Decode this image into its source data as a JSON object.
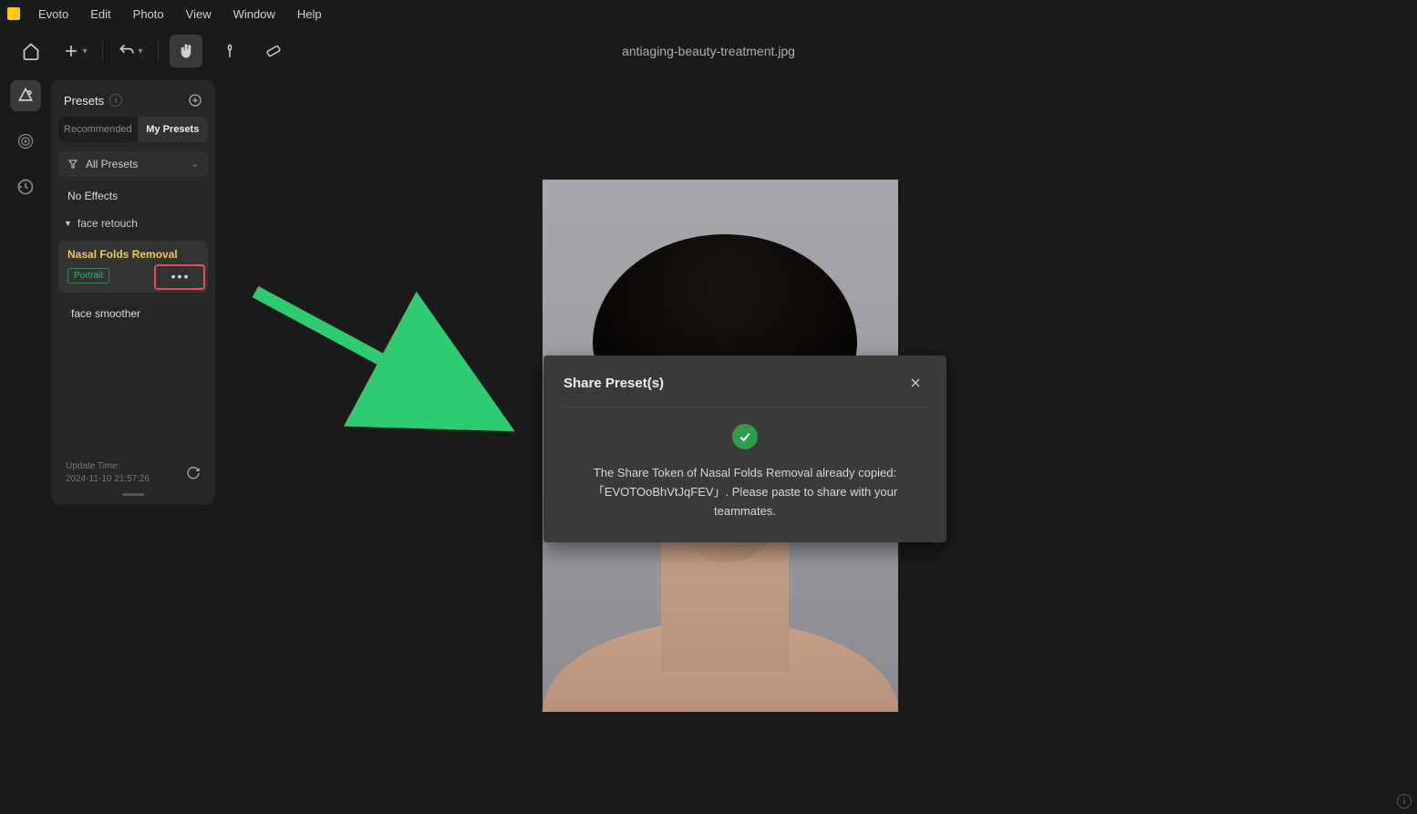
{
  "menubar": {
    "app": "Evoto",
    "items": [
      "Edit",
      "Photo",
      "View",
      "Window",
      "Help"
    ]
  },
  "toolbar": {
    "file_title": "antiaging-beauty-treatment.jpg"
  },
  "panel": {
    "title": "Presets",
    "tabs": {
      "recommended": "Recommended",
      "my": "My Presets"
    },
    "filter_label": "All Presets",
    "no_effects": "No Effects",
    "group_label": "face retouch",
    "active_preset": {
      "name": "Nasal Folds Removal",
      "tag": "Portrait"
    },
    "other_preset": "face smoother",
    "update_label": "Update Time:",
    "update_time": "2024-11-10 21:57:26"
  },
  "modal": {
    "title": "Share Preset(s)",
    "text": "The Share Token of Nasal Folds Removal already copied: 「EVOTOoBhVtJqFEV」. Please paste to share with your teammates."
  }
}
